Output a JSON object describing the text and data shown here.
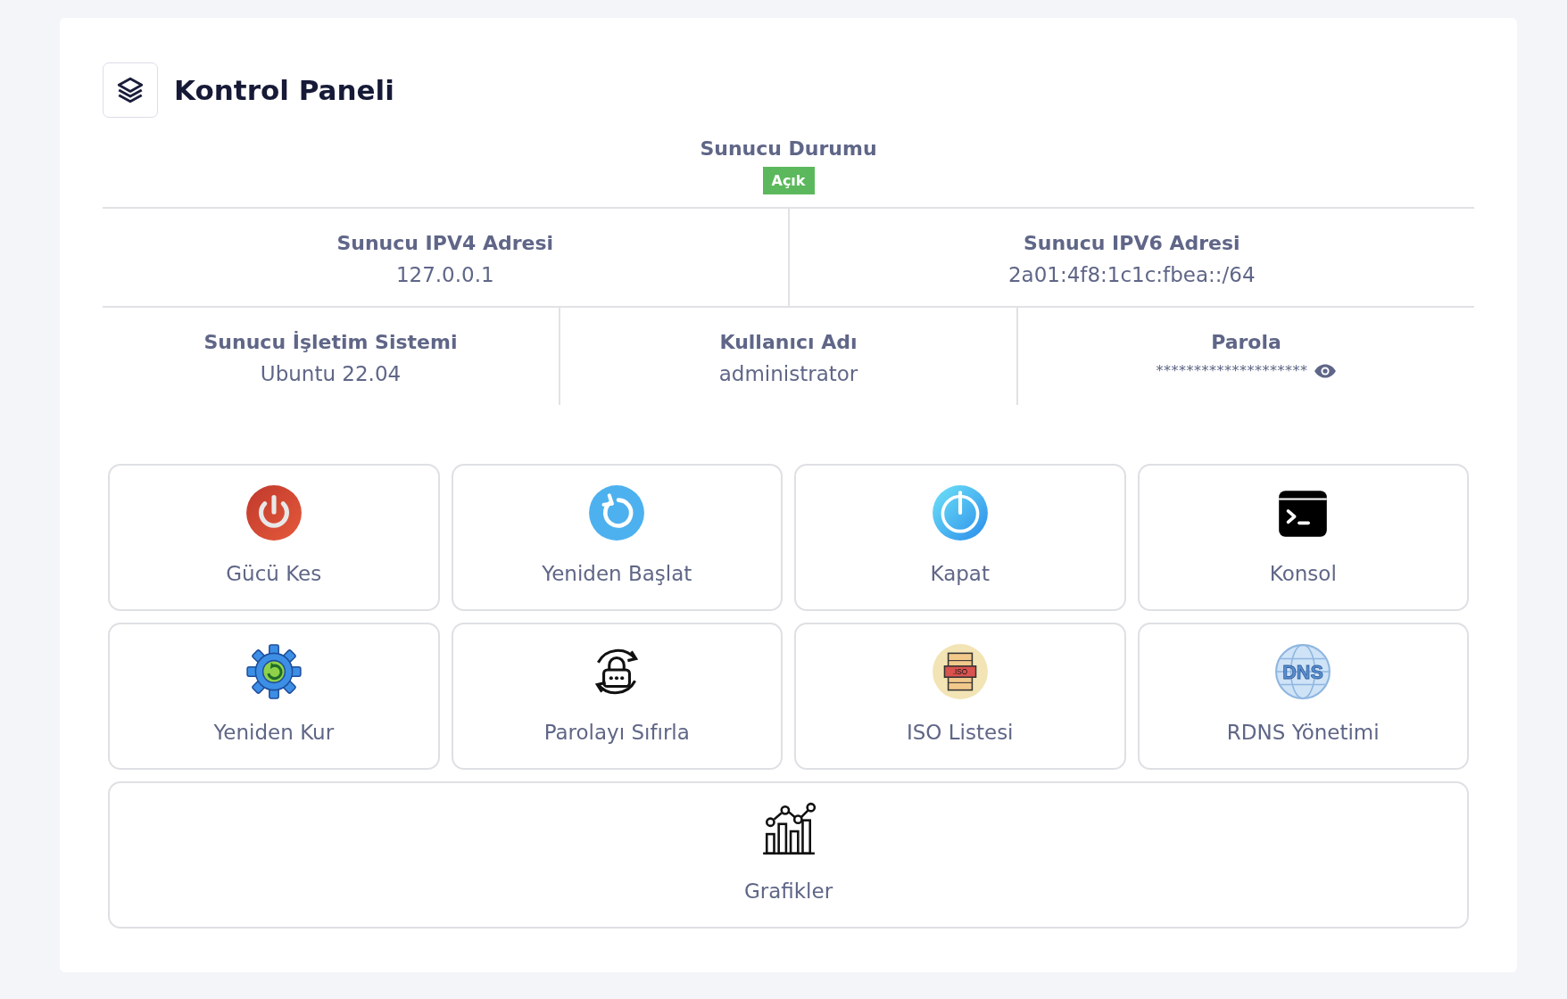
{
  "header": {
    "title": "Kontrol Paneli"
  },
  "status": {
    "label": "Sunucu Durumu",
    "badge": "Açık",
    "online": true
  },
  "info_rows": [
    [
      {
        "label": "Sunucu IPV4 Adresi",
        "value": "127.0.0.1"
      },
      {
        "label": "Sunucu IPV6 Adresi",
        "value": "2a01:4f8:1c1c:fbea::/64"
      }
    ],
    [
      {
        "label": "Sunucu İşletim Sistemi",
        "value": "Ubuntu 22.04"
      },
      {
        "label": "Kullanıcı Adı",
        "value": "administrator"
      },
      {
        "label": "Parola",
        "value": "********************",
        "kind": "password"
      }
    ]
  ],
  "actions": [
    {
      "label": "Gücü Kes",
      "kind": "power-off"
    },
    {
      "label": "Yeniden Başlat",
      "kind": "restart"
    },
    {
      "label": "Kapat",
      "kind": "shutdown"
    },
    {
      "label": "Konsol",
      "kind": "console"
    },
    {
      "label": "Yeniden Kur",
      "kind": "reinstall"
    },
    {
      "label": "Parolayı Sıfırla",
      "kind": "reset-password"
    },
    {
      "label": "ISO Listesi",
      "kind": "iso",
      "icon_text": ".ISO"
    },
    {
      "label": "RDNS Yönetimi",
      "kind": "dns",
      "icon_text": "DNS"
    },
    {
      "label": "Grafikler",
      "kind": "charts",
      "wide": true
    }
  ]
}
